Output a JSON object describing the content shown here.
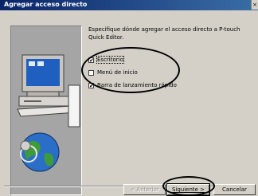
{
  "window": {
    "title": "Agregar acceso directo",
    "close_glyph": "×"
  },
  "description": "Especifique dónde agregar el acceso directo a P-touch Quick Editor.",
  "options": [
    {
      "label": "Escritorio",
      "checked": true
    },
    {
      "label": "Menú de inicio",
      "checked": false
    },
    {
      "label": "Barra de lanzamiento rápido",
      "checked": true
    }
  ],
  "buttons": {
    "back": "< Anterior",
    "next": "Siguiente >",
    "cancel": "Cancelar"
  },
  "check_glyph": "✔",
  "illustration": {
    "icon": "computer-and-globe-icon"
  }
}
